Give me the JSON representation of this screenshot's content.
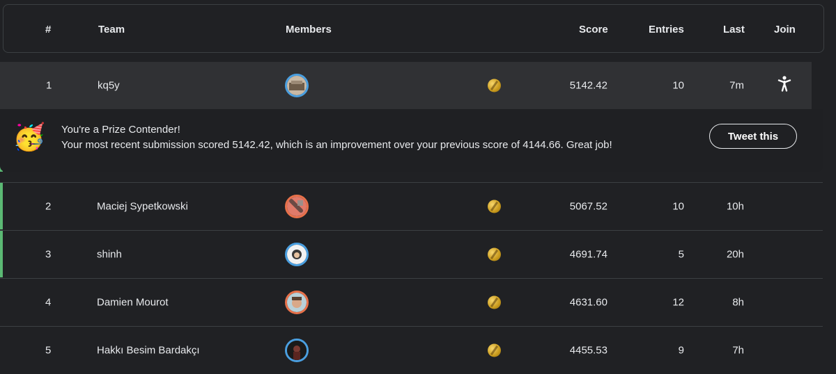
{
  "header": {
    "rank": "#",
    "team": "Team",
    "members": "Members",
    "score": "Score",
    "entries": "Entries",
    "last": "Last",
    "join": "Join"
  },
  "rows": [
    {
      "rank": "1",
      "team": "kq5y",
      "score": "5142.42",
      "entries": "10",
      "last": "7m"
    },
    {
      "rank": "2",
      "team": "Maciej Sypetkowski",
      "score": "5067.52",
      "entries": "10",
      "last": "10h"
    },
    {
      "rank": "3",
      "team": "shinh",
      "score": "4691.74",
      "entries": "5",
      "last": "20h"
    },
    {
      "rank": "4",
      "team": "Damien Mourot",
      "score": "4631.60",
      "entries": "12",
      "last": "8h"
    },
    {
      "rank": "5",
      "team": "Hakkı Besim Bardakçı",
      "score": "4455.53",
      "entries": "9",
      "last": "7h"
    }
  ],
  "banner": {
    "emoji": "🥳",
    "title": "You're a Prize Contender!",
    "message": "Your most recent submission scored 5142.42, which is an improvement over your previous score of 4144.66. Great job!",
    "button": "Tweet this"
  },
  "icons": {
    "medal": "gold-medal-icon",
    "join": "person-walking-icon"
  },
  "colors": {
    "accent": "#5bb974",
    "avatar_blue": "#4a9fe0",
    "avatar_orange": "#e8714a",
    "gold": "#d6a72a"
  }
}
